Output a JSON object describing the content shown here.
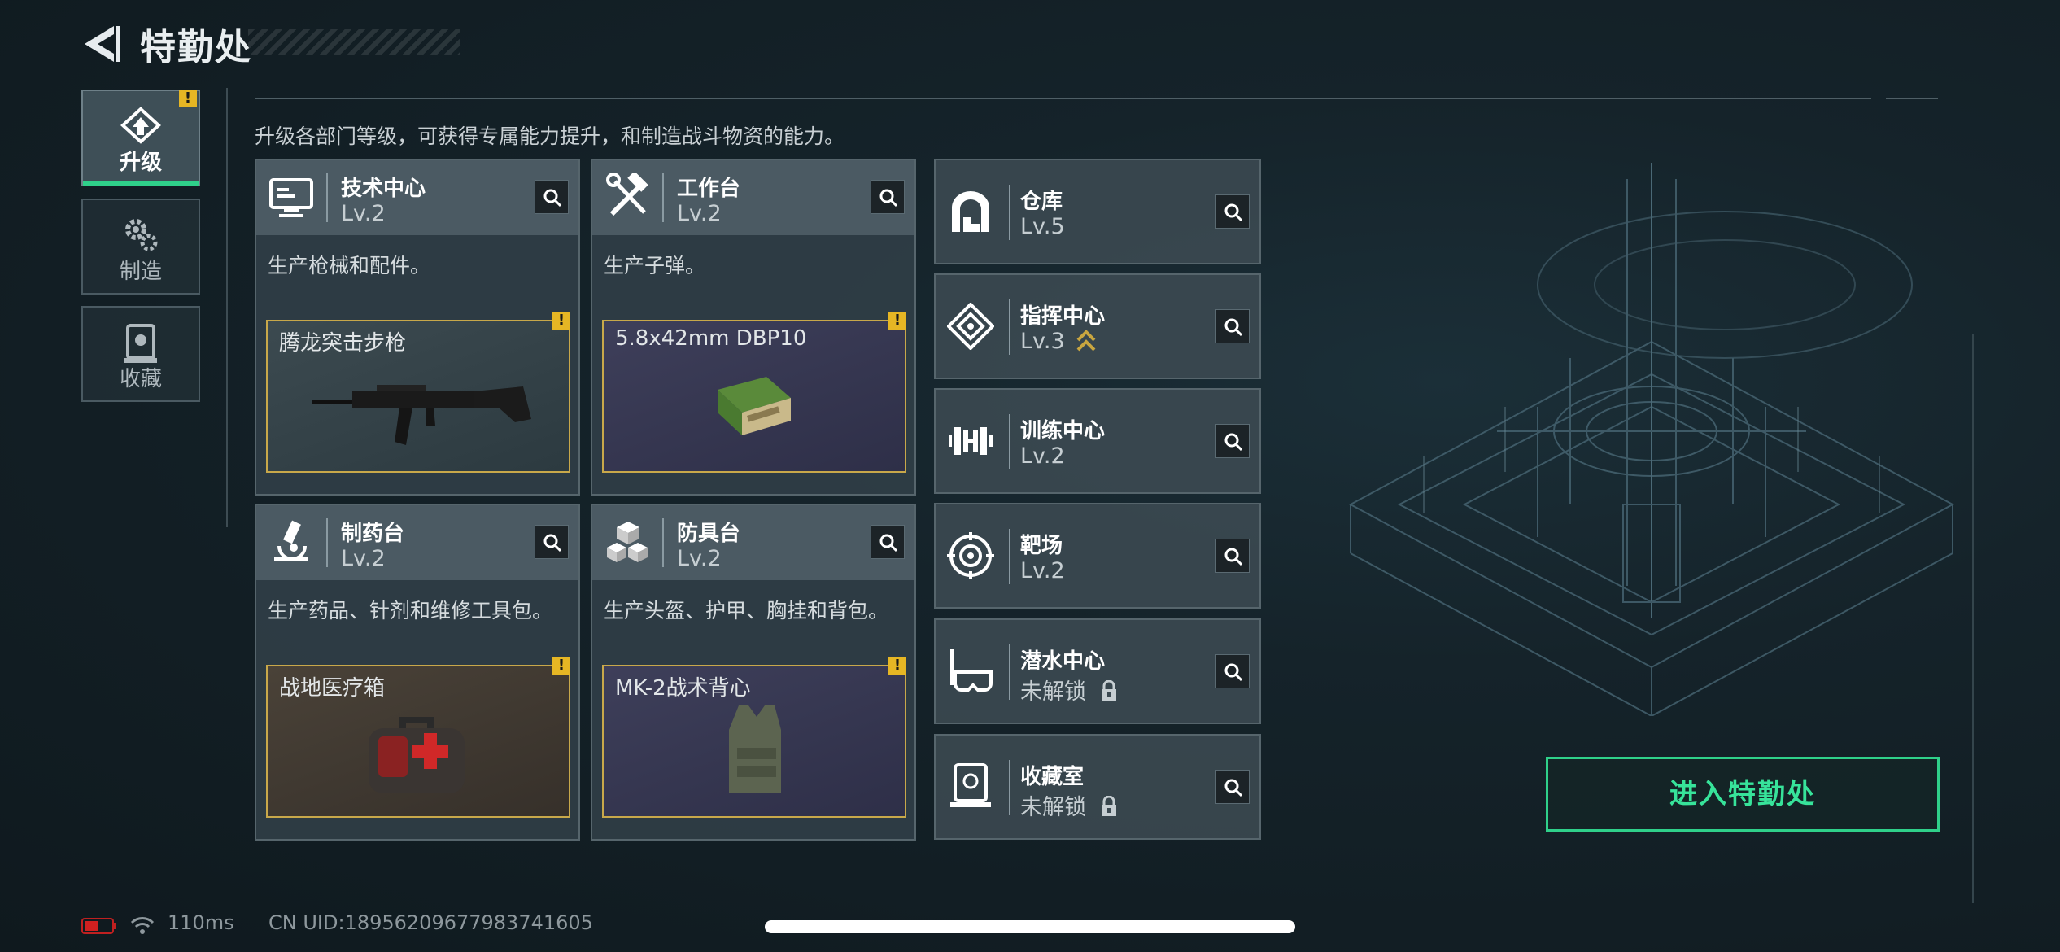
{
  "header": {
    "title": "特勤处",
    "back_icon": "back-arrow-icon"
  },
  "sidebar": {
    "tabs": [
      {
        "label": "升级",
        "icon": "upgrade-icon",
        "active": true,
        "alert": "!"
      },
      {
        "label": "制造",
        "icon": "gears-icon",
        "active": false
      },
      {
        "label": "收藏",
        "icon": "collection-icon",
        "active": false
      }
    ]
  },
  "main": {
    "subtitle": "升级各部门等级，可获得专属能力提升，和制造战斗物资的能力。",
    "cards": [
      {
        "name": "技术中心",
        "level": "Lv.2",
        "icon": "monitor-icon",
        "desc": "生产枪械和配件。",
        "product": {
          "name": "腾龙突击步枪",
          "image": "rifle-image",
          "alert": "!"
        }
      },
      {
        "name": "工作台",
        "level": "Lv.2",
        "icon": "hammer-wrench-icon",
        "desc": "生产子弹。",
        "product": {
          "name": "5.8x42mm DBP10",
          "image": "ammo-box-image",
          "alert": "!"
        }
      },
      {
        "name": "制药台",
        "level": "Lv.2",
        "icon": "microscope-icon",
        "desc": "生产药品、针剂和维修工具包。",
        "product": {
          "name": "战地医疗箱",
          "image": "medkit-image",
          "alert": "!"
        }
      },
      {
        "name": "防具台",
        "level": "Lv.2",
        "icon": "cubes-icon",
        "desc": "生产头盔、护甲、胸挂和背包。",
        "product": {
          "name": "MK-2战术背心",
          "image": "vest-image",
          "alert": "!"
        }
      }
    ],
    "facilities": [
      {
        "name": "仓库",
        "status": "Lv.5",
        "icon": "warehouse-icon"
      },
      {
        "name": "指挥中心",
        "status": "Lv.3",
        "icon": "command-icon",
        "upgradable": true
      },
      {
        "name": "训练中心",
        "status": "Lv.2",
        "icon": "dumbbell-icon"
      },
      {
        "name": "靶场",
        "status": "Lv.2",
        "icon": "target-icon"
      },
      {
        "name": "潜水中心",
        "status": "未解锁",
        "icon": "diving-mask-icon",
        "locked": true
      },
      {
        "name": "收藏室",
        "status": "未解锁",
        "icon": "collection-room-icon",
        "locked": true
      }
    ],
    "enter_button": "进入特勤处"
  },
  "status_bar": {
    "ping": "110ms",
    "uid": "CN UID:18956209677983741605"
  },
  "colors": {
    "accent_green": "#2fd08a",
    "alert_yellow": "#e6b624",
    "product_border": "#c8a84a"
  }
}
